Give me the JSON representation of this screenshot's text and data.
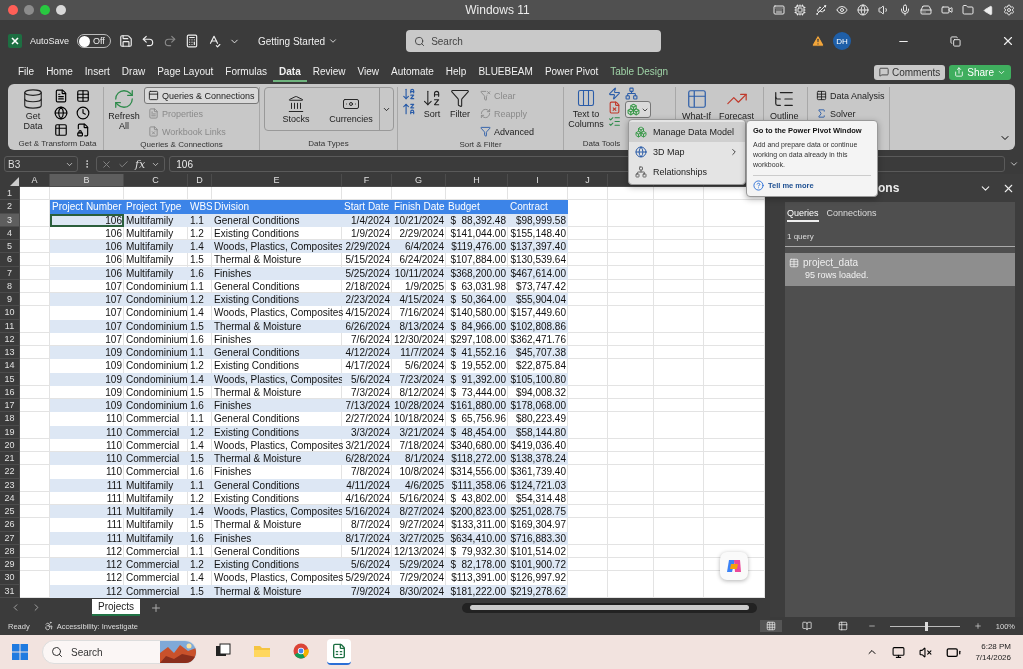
{
  "mac_bar": {
    "title": "Windows 11"
  },
  "titlebar": {
    "autosave_label": "AutoSave",
    "autosave": {
      "label": "Off",
      "on": false
    },
    "document": "Getting Started",
    "search": {
      "placeholder": "Search"
    },
    "avatar": "DH"
  },
  "menu_tabs": [
    {
      "label": "File",
      "selected": false,
      "kind": "standard"
    },
    {
      "label": "Home",
      "selected": false,
      "kind": "standard"
    },
    {
      "label": "Insert",
      "selected": false,
      "kind": "standard"
    },
    {
      "label": "Draw",
      "selected": false,
      "kind": "standard"
    },
    {
      "label": "Page Layout",
      "selected": false,
      "kind": "standard"
    },
    {
      "label": "Formulas",
      "selected": false,
      "kind": "standard"
    },
    {
      "label": "Data",
      "selected": true,
      "kind": "standard"
    },
    {
      "label": "Review",
      "selected": false,
      "kind": "standard"
    },
    {
      "label": "View",
      "selected": false,
      "kind": "standard"
    },
    {
      "label": "Automate",
      "selected": false,
      "kind": "standard"
    },
    {
      "label": "Help",
      "selected": false,
      "kind": "standard"
    },
    {
      "label": "BLUEBEAM",
      "selected": false,
      "kind": "standard"
    },
    {
      "label": "Power Pivot",
      "selected": false,
      "kind": "standard"
    },
    {
      "label": "Table Design",
      "selected": false,
      "kind": "contextual"
    }
  ],
  "comments_button": "Comments",
  "share_button": "Share",
  "ribbon": {
    "groups": [
      {
        "label": "Get & Transform Data",
        "buttons": [
          {
            "label": "Get Data",
            "disabled": false
          }
        ]
      },
      {
        "label": "Queries & Connections",
        "buttons": [
          {
            "label": "Refresh All",
            "disabled": false
          },
          {
            "label": "Queries & Connections",
            "disabled": false
          },
          {
            "label": "Properties",
            "disabled": true
          },
          {
            "label": "Workbook Links",
            "disabled": true
          }
        ]
      },
      {
        "label": "Data Types",
        "buttons": [
          {
            "label": "Stocks",
            "disabled": false
          },
          {
            "label": "Currencies",
            "disabled": false
          }
        ]
      },
      {
        "label": "Sort & Filter",
        "buttons": [
          {
            "label": "Sort",
            "disabled": false
          },
          {
            "label": "Filter",
            "disabled": false
          },
          {
            "label": "Clear",
            "disabled": true
          },
          {
            "label": "Reapply",
            "disabled": true
          },
          {
            "label": "Advanced",
            "disabled": false
          }
        ]
      },
      {
        "label": "Data Tools",
        "buttons": [
          {
            "label": "Text to Columns",
            "disabled": false
          }
        ]
      },
      {
        "buttons": [
          {
            "label": "What-If",
            "disabled": false
          },
          {
            "label": "Forecast",
            "disabled": false
          }
        ]
      },
      {
        "buttons": [
          {
            "label": "Outline",
            "disabled": false
          }
        ]
      },
      {
        "buttons": [
          {
            "label": "Data Analysis",
            "disabled": false
          },
          {
            "label": "Solver",
            "disabled": false
          }
        ]
      }
    ]
  },
  "dropdown": [
    {
      "label": "Manage Data Model",
      "selected": true,
      "submenu": false
    },
    {
      "label": "3D Map",
      "selected": false,
      "submenu": true
    },
    {
      "label": "Relationships",
      "selected": false,
      "submenu": false
    }
  ],
  "tooltip": {
    "title": "Go to the Power Pivot Window",
    "body": "Add and prepare data or continue working on data already in this workbook.",
    "link": "Tell me more"
  },
  "formula_bar": {
    "cell": "B3",
    "function_label": "fx",
    "value": "106"
  },
  "sheet": {
    "columns": [
      {
        "label": "A",
        "selected": false
      },
      {
        "label": "B",
        "selected": true
      },
      {
        "label": "C",
        "selected": false
      },
      {
        "label": "D",
        "selected": false
      },
      {
        "label": "E",
        "selected": false
      },
      {
        "label": "F",
        "selected": false
      },
      {
        "label": "G",
        "selected": false
      },
      {
        "label": "H",
        "selected": false
      },
      {
        "label": "I",
        "selected": false
      },
      {
        "label": "J",
        "selected": false
      }
    ],
    "row_numbers": [
      "1",
      "2",
      "3",
      "4",
      "5",
      "6",
      "7",
      "8",
      "9",
      "10",
      "11",
      "12",
      "13",
      "14",
      "15",
      "16",
      "17",
      "18",
      "19",
      "20",
      "21",
      "22",
      "23",
      "24",
      "25",
      "26",
      "27",
      "28",
      "29",
      "30",
      "31"
    ],
    "table": {
      "headers": [
        "Project Number",
        "Project Type",
        "WBS",
        "Division",
        "Start Date",
        "Finish Date",
        "Budget",
        "Contract"
      ],
      "rows": [
        {
          "selected": true,
          "cells": [
            "106",
            "Multifamily",
            "1.1",
            "General Conditions",
            "1/4/2024",
            "10/21/2024",
            "$  88,392.48",
            "$98,999.58"
          ]
        },
        {
          "selected": false,
          "cells": [
            "106",
            "Multifamily",
            "1.2",
            "Existing Conditions",
            "1/9/2024",
            "2/29/2024",
            "$141,044.00",
            "$155,148.40"
          ]
        },
        {
          "selected": false,
          "cells": [
            "106",
            "Multifamily",
            "1.4",
            "Woods, Plastics, Composites",
            "2/29/2024",
            "6/4/2024",
            "$119,476.00",
            "$137,397.40"
          ]
        },
        {
          "selected": false,
          "cells": [
            "106",
            "Multifamily",
            "1.5",
            "Thermal & Moisture",
            "5/15/2024",
            "6/24/2024",
            "$107,884.00",
            "$130,539.64"
          ]
        },
        {
          "selected": false,
          "cells": [
            "106",
            "Multifamily",
            "1.6",
            "Finishes",
            "5/25/2024",
            "10/11/2024",
            "$368,200.00",
            "$467,614.00"
          ]
        },
        {
          "selected": false,
          "cells": [
            "107",
            "Condominium",
            "1.1",
            "General Conditions",
            "2/18/2024",
            "1/9/2025",
            "$  63,031.98",
            "$73,747.42"
          ]
        },
        {
          "selected": false,
          "cells": [
            "107",
            "Condominium",
            "1.2",
            "Existing Conditions",
            "2/23/2024",
            "4/15/2024",
            "$  50,364.00",
            "$55,904.04"
          ]
        },
        {
          "selected": false,
          "cells": [
            "107",
            "Condominium",
            "1.4",
            "Woods, Plastics, Composites",
            "4/15/2024",
            "7/16/2024",
            "$140,580.00",
            "$157,449.60"
          ]
        },
        {
          "selected": false,
          "cells": [
            "107",
            "Condominium",
            "1.5",
            "Thermal & Moisture",
            "6/26/2024",
            "8/13/2024",
            "$  84,966.00",
            "$102,808.86"
          ]
        },
        {
          "selected": false,
          "cells": [
            "107",
            "Condominium",
            "1.6",
            "Finishes",
            "7/6/2024",
            "12/30/2024",
            "$297,108.00",
            "$362,471.76"
          ]
        },
        {
          "selected": false,
          "cells": [
            "109",
            "Condominium",
            "1.1",
            "General Conditions",
            "4/12/2024",
            "11/7/2024",
            "$  41,552.16",
            "$45,707.38"
          ]
        },
        {
          "selected": false,
          "cells": [
            "109",
            "Condominium",
            "1.2",
            "Existing Conditions",
            "4/17/2024",
            "5/6/2024",
            "$  19,552.00",
            "$22,875.84"
          ]
        },
        {
          "selected": false,
          "cells": [
            "109",
            "Condominium",
            "1.4",
            "Woods, Plastics, Composites",
            "5/6/2024",
            "7/23/2024",
            "$  91,392.00",
            "$105,100.80"
          ]
        },
        {
          "selected": false,
          "cells": [
            "109",
            "Condominium",
            "1.5",
            "Thermal & Moisture",
            "7/3/2024",
            "8/12/2024",
            "$  73,444.00",
            "$94,008.32"
          ]
        },
        {
          "selected": false,
          "cells": [
            "109",
            "Condominium",
            "1.6",
            "Finishes",
            "7/13/2024",
            "10/28/2024",
            "$161,880.00",
            "$178,068.00"
          ]
        },
        {
          "selected": false,
          "cells": [
            "110",
            "Commercial",
            "1.1",
            "General Conditions",
            "2/27/2024",
            "10/18/2024",
            "$  65,756.96",
            "$80,223.49"
          ]
        },
        {
          "selected": false,
          "cells": [
            "110",
            "Commercial",
            "1.2",
            "Existing Conditions",
            "3/3/2024",
            "3/21/2024",
            "$  48,454.00",
            "$58,144.80"
          ]
        },
        {
          "selected": false,
          "cells": [
            "110",
            "Commercial",
            "1.4",
            "Woods, Plastics, Composites",
            "3/21/2024",
            "7/18/2024",
            "$340,680.00",
            "$419,036.40"
          ]
        },
        {
          "selected": false,
          "cells": [
            "110",
            "Commercial",
            "1.5",
            "Thermal & Moisture",
            "6/28/2024",
            "8/1/2024",
            "$118,272.00",
            "$138,378.24"
          ]
        },
        {
          "selected": false,
          "cells": [
            "110",
            "Commercial",
            "1.6",
            "Finishes",
            "7/8/2024",
            "10/8/2024",
            "$314,556.00",
            "$361,739.40"
          ]
        },
        {
          "selected": false,
          "cells": [
            "111",
            "Multifamily",
            "1.1",
            "General Conditions",
            "4/11/2024",
            "4/6/2025",
            "$111,358.06",
            "$124,721.03"
          ]
        },
        {
          "selected": false,
          "cells": [
            "111",
            "Multifamily",
            "1.2",
            "Existing Conditions",
            "4/16/2024",
            "5/16/2024",
            "$  43,802.00",
            "$54,314.48"
          ]
        },
        {
          "selected": false,
          "cells": [
            "111",
            "Multifamily",
            "1.4",
            "Woods, Plastics, Composites",
            "5/16/2024",
            "8/27/2024",
            "$200,823.00",
            "$251,028.75"
          ]
        },
        {
          "selected": false,
          "cells": [
            "111",
            "Multifamily",
            "1.5",
            "Thermal & Moisture",
            "8/7/2024",
            "9/27/2024",
            "$133,311.00",
            "$169,304.97"
          ]
        },
        {
          "selected": false,
          "cells": [
            "111",
            "Multifamily",
            "1.6",
            "Finishes",
            "8/17/2024",
            "3/27/2025",
            "$634,410.00",
            "$716,883.30"
          ]
        },
        {
          "selected": false,
          "cells": [
            "112",
            "Commercial",
            "1.1",
            "General Conditions",
            "5/1/2024",
            "12/13/2024",
            "$  79,932.30",
            "$101,514.02"
          ]
        },
        {
          "selected": false,
          "cells": [
            "112",
            "Commercial",
            "1.2",
            "Existing Conditions",
            "5/6/2024",
            "5/29/2024",
            "$  82,178.00",
            "$101,900.72"
          ]
        },
        {
          "selected": false,
          "cells": [
            "112",
            "Commercial",
            "1.4",
            "Woods, Plastics, Composites",
            "5/29/2024",
            "7/29/2024",
            "$113,391.00",
            "$126,997.92"
          ]
        },
        {
          "selected": false,
          "cells": [
            "112",
            "Commercial",
            "1.5",
            "Thermal & Moisture",
            "7/9/2024",
            "8/30/2024",
            "$181,222.00",
            "$219,278.62"
          ]
        }
      ]
    }
  },
  "pane": {
    "title": "ons",
    "tabs": [
      {
        "label": "Queries",
        "selected": true
      },
      {
        "label": "Connections",
        "selected": false
      }
    ],
    "count": "1 query",
    "queries": [
      {
        "name": "project_data",
        "status": "95 rows loaded."
      }
    ]
  },
  "sheet_tabs": [
    {
      "label": "Projects",
      "selected": true
    }
  ],
  "status_bar": {
    "ready": "Ready",
    "accessibility": "Accessibility: Investigate",
    "zoom": {
      "level": 0.5
    },
    "zoom_label": "100%"
  },
  "taskbar": {
    "search": {
      "placeholder": "Search"
    },
    "time": "6:28 PM",
    "date": "7/14/2026"
  }
}
